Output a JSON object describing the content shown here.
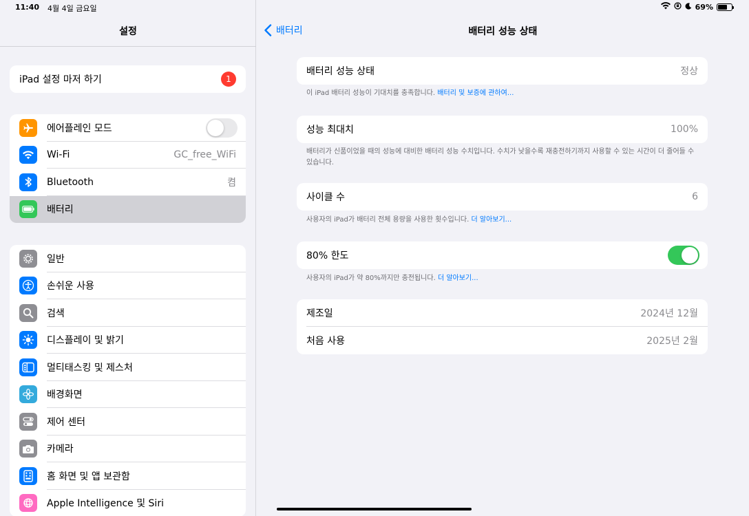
{
  "status": {
    "time": "11:40",
    "date": "4월 4일 금요일",
    "battery_percent": "69%",
    "battery_level": 0.69
  },
  "sidebar": {
    "title": "설정",
    "setup": {
      "label": "iPad 설정 마저 하기",
      "badge": "1"
    },
    "connectivity": [
      {
        "label": "에어플레인 모드",
        "icon": "airplane-icon",
        "color": "#ff9500",
        "toggle": false
      },
      {
        "label": "Wi-Fi",
        "icon": "wifi-icon",
        "color": "#007aff",
        "value": "GC_free_WiFi"
      },
      {
        "label": "Bluetooth",
        "icon": "bluetooth-icon",
        "color": "#007aff",
        "value": "켬"
      },
      {
        "label": "배터리",
        "icon": "battery-icon",
        "color": "#34c759",
        "selected": true
      }
    ],
    "general": [
      {
        "label": "일반",
        "icon": "gear-icon",
        "color": "#8e8e93"
      },
      {
        "label": "손쉬운 사용",
        "icon": "accessibility-icon",
        "color": "#007aff"
      },
      {
        "label": "검색",
        "icon": "search-icon",
        "color": "#8e8e93"
      },
      {
        "label": "디스플레이 및 밝기",
        "icon": "brightness-icon",
        "color": "#007aff"
      },
      {
        "label": "멀티태스킹 및 제스처",
        "icon": "multitasking-icon",
        "color": "#007aff"
      },
      {
        "label": "배경화면",
        "icon": "wallpaper-icon",
        "color": "#34aadc"
      },
      {
        "label": "제어 센터",
        "icon": "control-center-icon",
        "color": "#8e8e93"
      },
      {
        "label": "카메라",
        "icon": "camera-icon",
        "color": "#8e8e93"
      },
      {
        "label": "홈 화면 및 앱 보관함",
        "icon": "home-screen-icon",
        "color": "#007aff"
      },
      {
        "label": "Apple Intelligence 및 Siri",
        "icon": "siri-icon",
        "color": "#ff6ac1"
      }
    ]
  },
  "detail": {
    "back_label": "배터리",
    "title": "배터리 성능 상태",
    "health": {
      "label": "배터리 성능 상태",
      "value": "정상",
      "note": "이 iPad 배터리 성능이 기대치를 충족합니다.",
      "note_link": "배터리 및 보증에 관하여..."
    },
    "max_capacity": {
      "label": "성능 최대치",
      "value": "100%",
      "note": "배터리가 신품이었을 때의 성능에 대비한 배터리 성능 수치입니다. 수치가 낮을수록 재충전하기까지 사용할 수 있는 시간이 더 줄어들 수 있습니다."
    },
    "cycle_count": {
      "label": "사이클 수",
      "value": "6",
      "note": "사용자의 iPad가 배터리 전체 용량을 사용한 횟수입니다.",
      "note_link": "더 알아보기..."
    },
    "limit": {
      "label": "80% 한도",
      "toggle": true,
      "note": "사용자의 iPad가 약 80%까지만 충전됩니다.",
      "note_link": "더 알아보기..."
    },
    "dates": {
      "manufacture_label": "제조일",
      "manufacture_value": "2024년 12월",
      "first_use_label": "처음 사용",
      "first_use_value": "2025년 2월"
    }
  }
}
